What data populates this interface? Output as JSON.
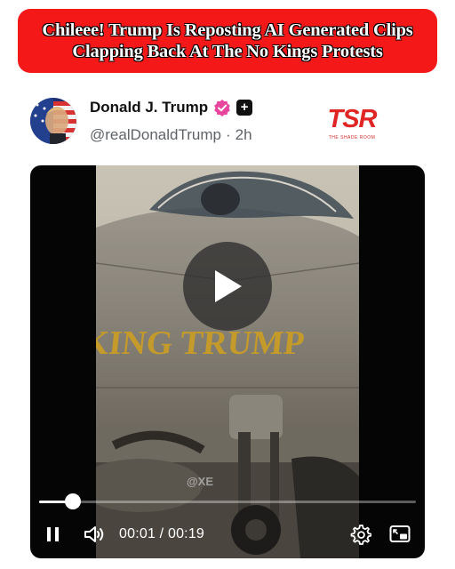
{
  "banner": {
    "line1": "Chileee! Trump Is Reposting AI Generated Clips",
    "line2": "Clapping Back At The No Kings Protests"
  },
  "post": {
    "author_name": "Donald J. Trump",
    "handle": "@realDonaldTrump",
    "separator": "·",
    "time_ago": "2h"
  },
  "brand_logo": {
    "letters": "TSR",
    "tagline": "THE SHADE ROOM"
  },
  "video": {
    "aircraft_text": "KING TRUMP",
    "watermark": "@XE",
    "time_display": "00:01 / 00:19",
    "progress_fraction": 0.09
  },
  "colors": {
    "banner_red": "#f41818",
    "verified_pink": "#e8459f",
    "player_bg": "#050505",
    "logo_red": "#e02525"
  },
  "icons": [
    "verified-badge-icon",
    "plus-icon",
    "play-icon",
    "pause-icon",
    "volume-icon",
    "gear-icon",
    "picture-in-picture-icon"
  ]
}
